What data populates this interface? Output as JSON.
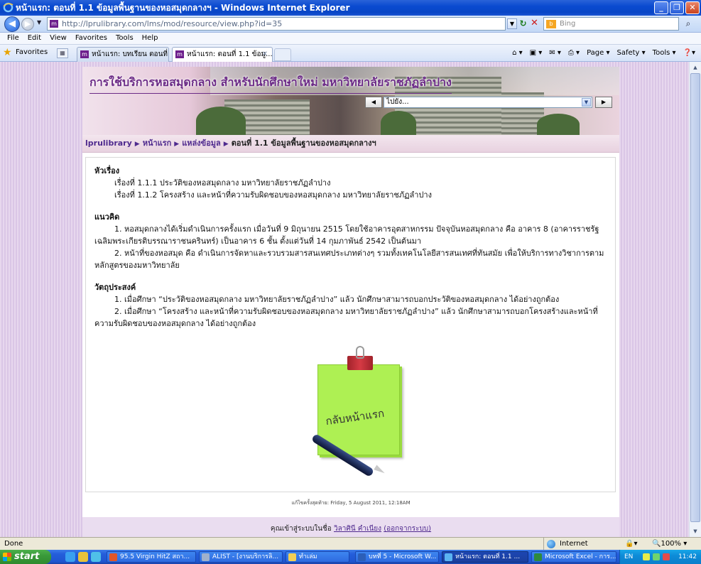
{
  "window": {
    "title": "หน้าแรก: ตอนที่ 1.1 ข้อมูลพื้นฐานของหอสมุดกลางฯ - Windows Internet Explorer"
  },
  "address": {
    "url": "http://lprulibrary.com/lms/mod/resource/view.php?id=35",
    "search_placeholder": "Bing"
  },
  "menu": [
    "File",
    "Edit",
    "View",
    "Favorites",
    "Tools",
    "Help"
  ],
  "favorites_label": "Favorites",
  "tabs": [
    {
      "label": "หน้าแรก: บทเรียน ตอนที่ 1.1"
    },
    {
      "label": "หน้าแรก: ตอนที่ 1.1 ข้อมู...",
      "close": "✕"
    }
  ],
  "commands": [
    "Page ▾",
    "Safety ▾",
    "Tools ▾"
  ],
  "page": {
    "banner_title": "การใช้บริการหอสมุดกลาง สำหรับนักศึกษาใหม่ มหาวิทยาลัยราชภัฏลำปาง",
    "jump_value": "ไปยัง...",
    "breadcrumb": {
      "items": [
        "lprulibrary",
        "หน้าแรก",
        "แหล่งข้อมูล"
      ],
      "current": "ตอนที่ 1.1 ข้อมูลพื้นฐานของหอสมุดกลางฯ"
    },
    "topics": {
      "heading": "หัวเรื่อง",
      "lines": [
        "เรื่องที่ 1.1.1 ประวัติของหอสมุดกลาง มหาวิทยาลัยราชภัฏลำปาง",
        "เรื่องที่ 1.1.2 โครงสร้าง และหน้าที่ความรับผิดชอบของหอสมุดกลาง มหาวิทยาลัยราชภัฏลำปาง"
      ]
    },
    "concept": {
      "heading": "แนวคิด",
      "paragraphs": [
        "1. หอสมุดกลางได้เริ่มดำเนินการครั้งแรก เมื่อวันที่ 9 มิถุนายน 2515 โดยใช้อาคารอุตสาหกรรม ปัจจุบันหอสมุดกลาง คือ อาคาร 8 (อาคารราชรัฐเฉลิมพระเกียรติบรรณาราชนครินทร์) เป็นอาคาร 6 ชั้น ตั้งแต่วันที่ 14 กุมภาพันธ์ 2542 เป็นต้นมา",
        "2. หน้าที่ของหอสมุด คือ ดำเนินการจัดหาและรวบรวมสารสนเทศประเภทต่างๆ รวมทั้งเทคโนโลยีสารสนเทศที่ทันสมัย เพื่อให้บริการทางวิชาการตามหลักสูตรของมหาวิทยาลัย"
      ]
    },
    "objectives": {
      "heading": "วัตถุประสงค์",
      "paragraphs": [
        "1. เมื่อศึกษา “ประวัติของหอสมุดกลาง มหาวิทยาลัยราชภัฏลำปาง” แล้ว นักศึกษาสามารถบอกประวัติของหอสมุดกลาง ได้อย่างถูกต้อง",
        "2. เมื่อศึกษา “โครงสร้าง และหน้าที่ความรับผิดชอบของหอสมุดกลาง มหาวิทยาลัยราชภัฏลำปาง” แล้ว นักศึกษาสามารถบอกโครงสร้างและหน้าที่ความรับผิดชอบของหอสมุดกลาง ได้อย่างถูกต้อง"
      ]
    },
    "home_note_label": "กลับหน้าแรก",
    "last_modified": "แก้ไขครั้งสุดท้าย: Friday, 5 August 2011, 12:18AM",
    "footer": {
      "prefix": "คุณเข้าสู่ระบบในชื่อ",
      "user": "วิลาศินี คำเนียง",
      "logout": "(ออกจากระบบ)"
    }
  },
  "status": {
    "left": "Done",
    "zone": "Internet",
    "zoom": "100% ▾"
  },
  "taskbar": {
    "start": "start",
    "tasks": [
      "95.5 Virgin HitZ สถา...",
      "ALIST - [งานบริการลิ...",
      "ทำเล่ม",
      "บทที่ 5 - Microsoft W...",
      "หน้าแรก: ตอนที่ 1.1 ...",
      "Microsoft Excel - การ..."
    ],
    "lang": "EN",
    "clock": "11:42"
  },
  "colors": {
    "brand_purple": "#6b2a86",
    "link": "#4f2a8e",
    "note_green": "#aef053"
  }
}
